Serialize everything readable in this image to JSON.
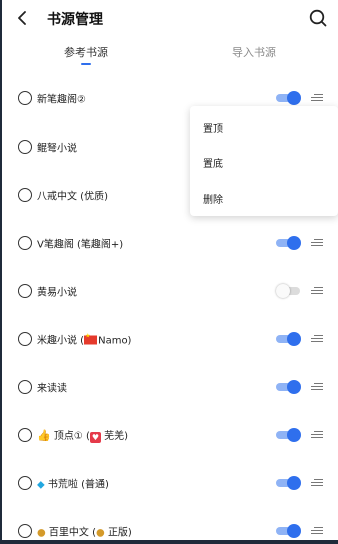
{
  "header": {
    "title": "书源管理",
    "back_icon": "chevron-left-icon",
    "search_icon": "search-icon"
  },
  "tabs": [
    {
      "label": "参考书源",
      "active": true
    },
    {
      "label": "导入书源",
      "active": false
    }
  ],
  "sources": [
    {
      "name": "新笔趣阁②",
      "enabled": true,
      "toggle_visible": true
    },
    {
      "name": "鲲弩小说",
      "enabled": null,
      "toggle_visible": false
    },
    {
      "name": "八戒中文 (优质)",
      "enabled": null,
      "toggle_visible": false
    },
    {
      "name": "V笔趣阁 (笔趣阁+)",
      "enabled": true,
      "toggle_visible": true
    },
    {
      "name": "黄易小说",
      "enabled": false,
      "toggle_visible": true
    },
    {
      "prefix": "米趣小说 (",
      "flag_icon": "china-flag-icon",
      "suffix": "Namo)",
      "enabled": true,
      "toggle_visible": true
    },
    {
      "name": "来读读",
      "enabled": true,
      "toggle_visible": true
    },
    {
      "icon": "thumbs-up-icon",
      "prefix": "顶点① (",
      "icon2": "heart-icon",
      "suffix": "芜羌)",
      "enabled": true,
      "toggle_visible": true
    },
    {
      "icon": "gem-icon",
      "name": "书荒啦 (普通)",
      "enabled": true,
      "toggle_visible": true
    },
    {
      "icon": "money-bag-icon",
      "prefix": "百里中文 (",
      "icon2": "money-bag-icon",
      "suffix": "正版)",
      "enabled": true,
      "toggle_visible": true
    }
  ],
  "context_menu": {
    "items": [
      "置顶",
      "置底",
      "删除"
    ]
  },
  "colors": {
    "accent": "#2f6fed",
    "track_on": "#8fb3f5",
    "track_off": "#dcdcdc"
  }
}
